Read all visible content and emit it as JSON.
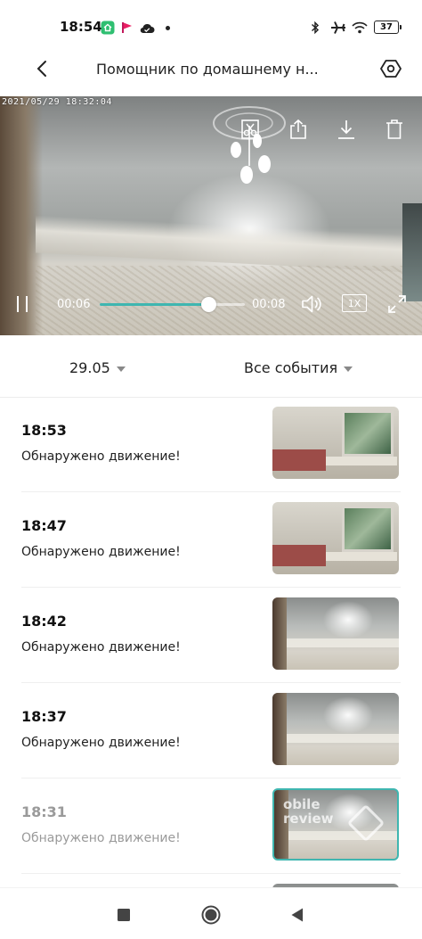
{
  "status_bar": {
    "time": "18:54",
    "battery": "37",
    "icons": [
      "mi-home-icon",
      "flag-icon",
      "cloud-icon",
      "dot-icon",
      "bluetooth-icon",
      "airplane-icon",
      "wifi-icon",
      "battery-icon"
    ]
  },
  "header": {
    "title": "Помощник по домашнему н...",
    "back_icon": "chevron-left-icon",
    "settings_icon": "hexagon-settings-icon"
  },
  "player": {
    "timestamp": "2021/05/29  18:32:04",
    "current_time": "00:06",
    "duration": "00:08",
    "progress": 0.75,
    "speed": "1X",
    "toolbar_icons": [
      "clip-icon",
      "share-icon",
      "download-icon",
      "delete-icon"
    ],
    "control_icons": [
      "pause-icon",
      "volume-icon",
      "speed-icon",
      "fullscreen-icon"
    ]
  },
  "filters": {
    "date": "29.05",
    "events": "Все события"
  },
  "events": [
    {
      "time": "18:53",
      "description": "Обнаружено движение!",
      "thumbnail": "window-view",
      "selected": false
    },
    {
      "time": "18:47",
      "description": "Обнаружено движение!",
      "thumbnail": "window-view",
      "selected": false
    },
    {
      "time": "18:42",
      "description": "Обнаружено движение!",
      "thumbnail": "ceiling-view",
      "selected": false
    },
    {
      "time": "18:37",
      "description": "Обнаружено движение!",
      "thumbnail": "ceiling-view",
      "selected": false
    },
    {
      "time": "18:31",
      "description": "Обнаружено движение!",
      "thumbnail": "ceiling-view",
      "selected": true
    }
  ],
  "watermark": {
    "line1": "obile",
    "line2": "review"
  },
  "colors": {
    "accent": "#3fb6b0",
    "dim_text": "#9a9a9a"
  },
  "nav_bar": {
    "icons": [
      "recents-square-icon",
      "home-circle-icon",
      "back-triangle-icon"
    ]
  }
}
